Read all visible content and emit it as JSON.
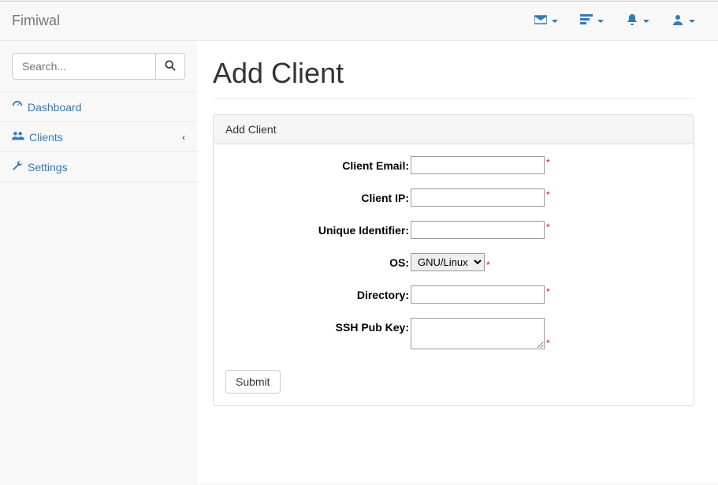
{
  "brand": "Fimiwal",
  "search": {
    "placeholder": "Search..."
  },
  "sidebar": {
    "items": [
      {
        "label": "Dashboard"
      },
      {
        "label": "Clients"
      },
      {
        "label": "Settings"
      }
    ]
  },
  "page": {
    "title": "Add Client",
    "panel_title": "Add Client"
  },
  "form": {
    "labels": {
      "email": "Client Email:",
      "ip": "Client IP:",
      "uid": "Unique Identifier:",
      "os": "OS:",
      "dir": "Directory:",
      "ssh": "SSH Pub Key:"
    },
    "os_options": [
      "GNU/Linux"
    ],
    "os_selected": "GNU/Linux",
    "required_marker": "*",
    "submit": "Submit"
  }
}
